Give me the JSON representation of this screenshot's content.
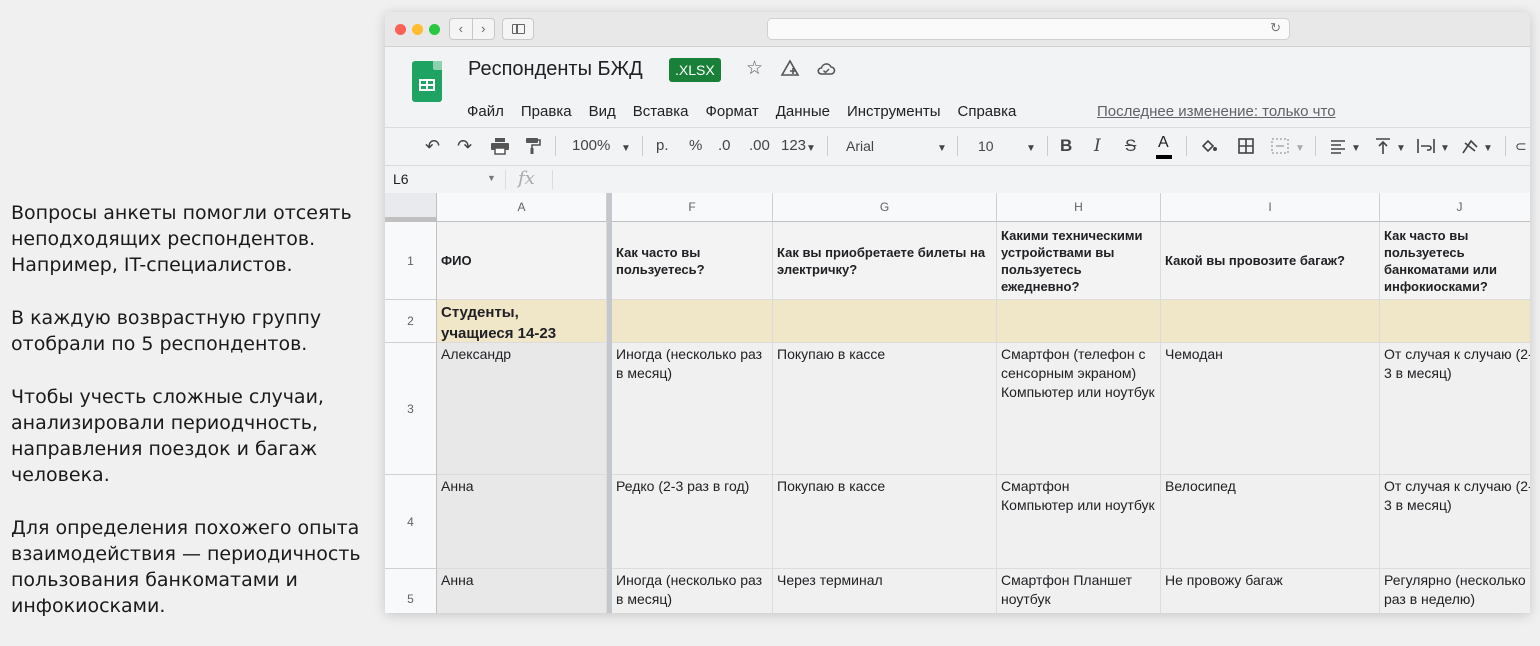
{
  "notes": [
    "Вопросы анкеты помогли отсеять неподходящих респондентов. Например, IT-специалистов.",
    "В каждую возврастную группу отобрали по 5 респондентов.",
    "Чтобы учесть сложные случаи, анализировали периодчность, направления поездок и багаж человека.",
    "Для определения похожего опыта взаимодействия — периодичность пользования банкоматами и инфокиосками."
  ],
  "doc": {
    "title": "Респонденты БЖД",
    "badge": ".XLSX",
    "last_edit": "Последнее изменение: только что"
  },
  "menu": [
    "Файл",
    "Правка",
    "Вид",
    "Вставка",
    "Формат",
    "Данные",
    "Инструменты",
    "Справка"
  ],
  "toolbar": {
    "zoom": "100%",
    "currency": "р.",
    "percent": "%",
    "dec_less": ".0",
    "dec_more": ".00",
    "format": "123",
    "font": "Arial",
    "font_size": "10",
    "bold": "B",
    "italic": "I",
    "strike": "S",
    "text_color": "A"
  },
  "formula_bar": {
    "cell_ref": "L6",
    "fx": "fx"
  },
  "sheet": {
    "columns": [
      "A",
      "F",
      "G",
      "H",
      "I",
      "J"
    ],
    "rows": [
      "1",
      "2",
      "3",
      "4",
      "5"
    ],
    "header": [
      "ФИО",
      "Как часто вы пользуетесь?",
      "Как вы приобретаете билеты на электричку?",
      "Какими техническими устройствами вы пользуетесь ежедневно?",
      "Какой вы провозите багаж?",
      "Как часто вы пользуетесь банкоматами или инфокиосками?"
    ],
    "group": "Студенты, учащиеся 14-23",
    "data": [
      [
        "Александр",
        "Иногда (несколько раз в месяц)",
        "Покупаю в кассе",
        "Смартфон (телефон с сенсорным экраном)\nКомпьютер или ноутбук",
        "Чемодан",
        "От случая к случаю (2-3 в месяц)"
      ],
      [
        "Анна",
        "Редко (2-3 раз в год)",
        "Покупаю в кассе",
        "Смартфон\nКомпьютер или ноутбук",
        "Велосипед",
        "От случая к случаю (2-3 в месяц)"
      ],
      [
        "Анна",
        "Иногда (несколько раз в месяц)",
        "Через терминал",
        "Смартфон Планшет ноутбук",
        "Не провожу багаж",
        "Регулярно (несколько раз в неделю)"
      ]
    ]
  },
  "colors": {
    "badge": "#188038",
    "group_row": "#f0e6c8",
    "sheets_green": "#1ea362"
  }
}
